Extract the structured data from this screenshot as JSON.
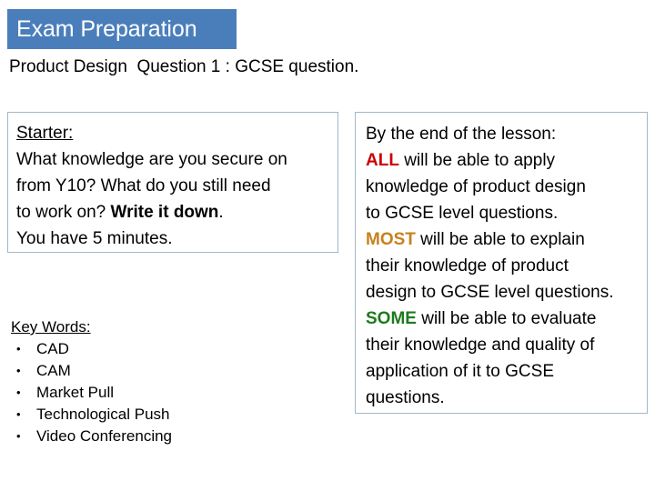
{
  "slide": {
    "title": "Exam Preparation",
    "title_bg_color": "#4A7EBB",
    "title_text_color": "#FFFFFF",
    "subtitle": "Product Design  Question 1 : GCSE question."
  },
  "starter_box": {
    "heading": "Starter:",
    "line1": "What knowledge are you secure on",
    "line2": "from Y10? What do you still need",
    "line3_prefix": "to work on? ",
    "line3_bold": "Write it down",
    "line3_suffix": ".",
    "line4": "You have 5 minutes."
  },
  "keywords": {
    "heading": "Key Words:",
    "bullet_glyph": "•",
    "items": [
      "CAD",
      "CAM",
      "Market Pull",
      "Technological Push",
      "Video Conferencing"
    ]
  },
  "objectives_box": {
    "intro": "By the end of the lesson:",
    "all_label": "ALL",
    "all_color": "#CC0000",
    "all_text_1": " will be able to apply",
    "all_text_2": "knowledge of product design",
    "all_text_3": "to GCSE level questions.",
    "most_label": "MOST",
    "most_color": "#C8811E",
    "most_text_1": " will be able to explain",
    "most_text_2": "their knowledge of product",
    "most_text_3": "design to GCSE level questions.",
    "some_label": "SOME",
    "some_color": "#1E7A1E",
    "some_text_1": " will be able to evaluate",
    "some_text_2": "their knowledge and quality of",
    "some_text_3": "application of it to GCSE",
    "some_text_4": "questions."
  }
}
